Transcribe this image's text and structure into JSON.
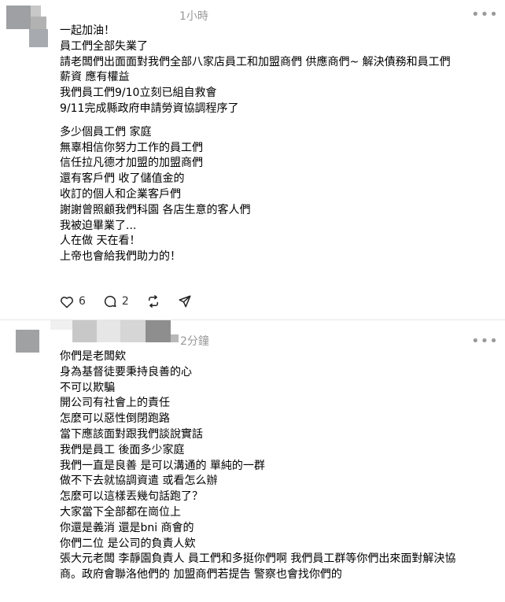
{
  "post1": {
    "time": "1小時",
    "lines": [
      "一起加油！",
      "員工們全部失業了",
      "請老闆們出面面對我們全部八家店員工和加盟商們 供應商們~ 解決債務和員工們",
      "薪資 應有權益",
      "我們員工們9/10立刻已組自救會",
      "9/11完成縣政府申請勞資協調程序了",
      "多少個員工們 家庭",
      "無辜相信你努力工作的員工們",
      "信任拉凡德才加盟的加盟商們",
      "還有客戶們 收了儲值金的",
      "收訂的個人和企業客戶們",
      "謝謝曾照顧我們科園 各店生意的客人們",
      "我被迫畢業了...",
      "人在做 天在看！",
      "上帝也會給我們助力的！"
    ],
    "actions": {
      "like_count": "6",
      "reply_count": "2",
      "like_icon": "heart-icon",
      "reply_icon": "comment-icon",
      "repost_icon": "repost-icon",
      "share_icon": "send-icon"
    }
  },
  "post2": {
    "time": "2分鐘",
    "lines": [
      "你們是老闆欸",
      "身為基督徒要秉持良善的心",
      "不可以欺騙",
      "開公司有社會上的責任",
      "怎麼可以惡性倒閉跑路",
      "當下應該面對跟我們談說實話",
      "我們是員工 後面多少家庭",
      "我們一直是良善 是可以溝通的 單純的一群",
      "做不下去就協調資遣 或看怎么辦",
      "怎麼可以這樣丟幾句話跑了？",
      "大家當下全部都在崗位上",
      "你還是義消 還是bni 商會的",
      "你們二位 是公司的負責人欸",
      "張大元老闆 李靜園負責人 員工們和多挺你們啊 我們員工群等你們出來面對解決協",
      "商。政府會聯洛他們的 加盟商們若提告 警察也會找你們的"
    ]
  },
  "colors": {
    "muted": "#999999",
    "divider": "#e5e5e5"
  }
}
